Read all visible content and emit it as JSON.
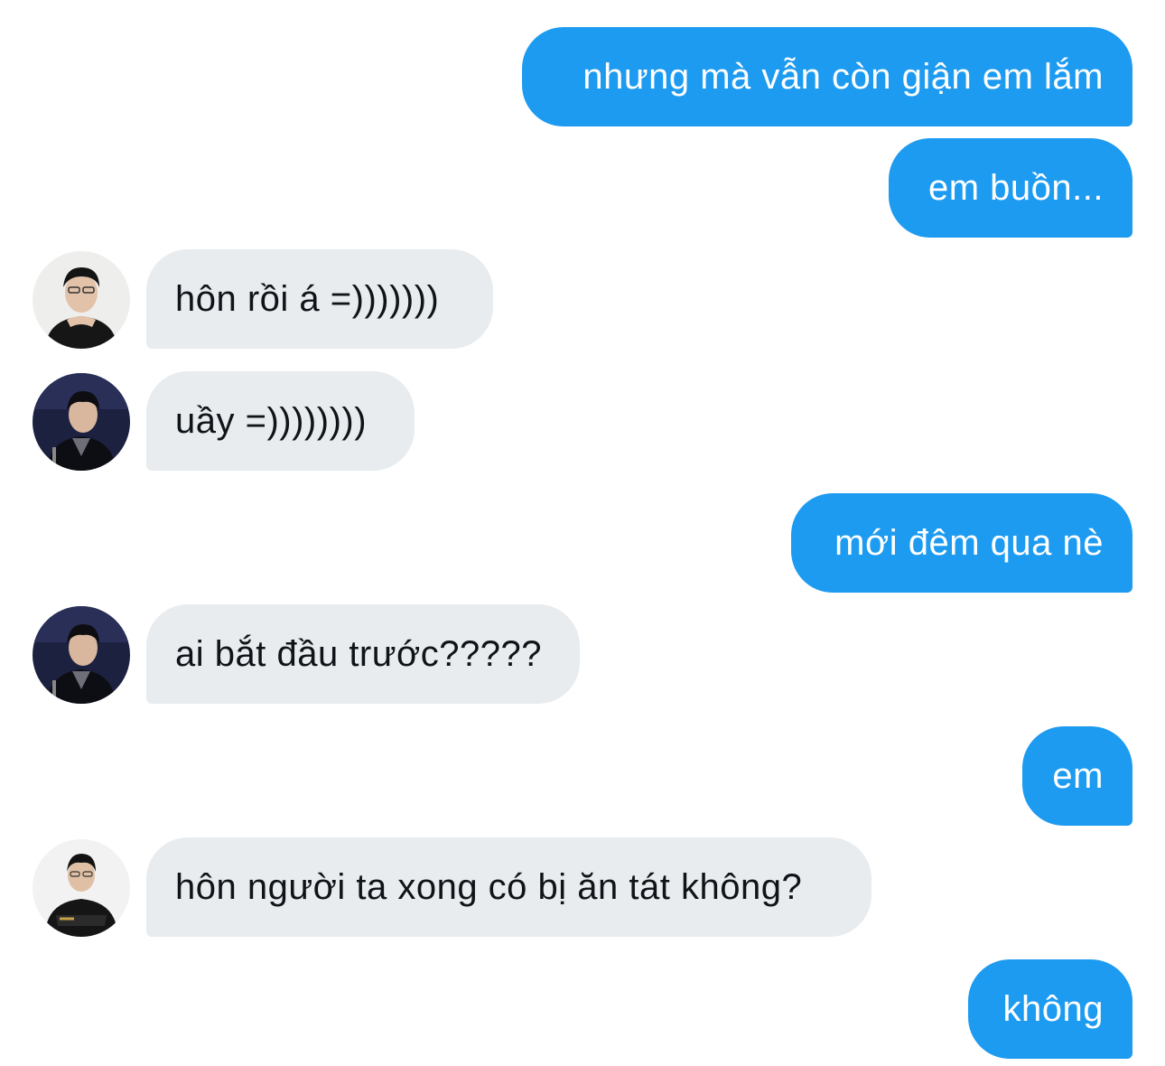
{
  "conversation": {
    "messages": [
      {
        "sender": "me",
        "text": "nhưng mà vẫn còn giận em lắm"
      },
      {
        "sender": "me",
        "text": "em buồn..."
      },
      {
        "sender": "other",
        "avatar": "person-in-white-background-avatar",
        "text": "hôn rồi á =)))))))"
      },
      {
        "sender": "other",
        "avatar": "person-in-dark-suit-avatar",
        "text": "uầy =))))))))"
      },
      {
        "sender": "me",
        "text": "mới đêm qua nè"
      },
      {
        "sender": "other",
        "avatar": "person-in-dark-suit-avatar",
        "text": "ai bắt đầu trước?????"
      },
      {
        "sender": "me",
        "text": "em"
      },
      {
        "sender": "other",
        "avatar": "person-in-black-jacket-avatar",
        "text": "hôn người ta xong có bị ăn tát không?"
      },
      {
        "sender": "me",
        "text": "không"
      }
    ]
  },
  "colors": {
    "outgoing_bubble": "#1d9bf0",
    "incoming_bubble": "#e8ecef",
    "outgoing_text": "#ffffff",
    "incoming_text": "#0f1419",
    "background": "#ffffff"
  }
}
